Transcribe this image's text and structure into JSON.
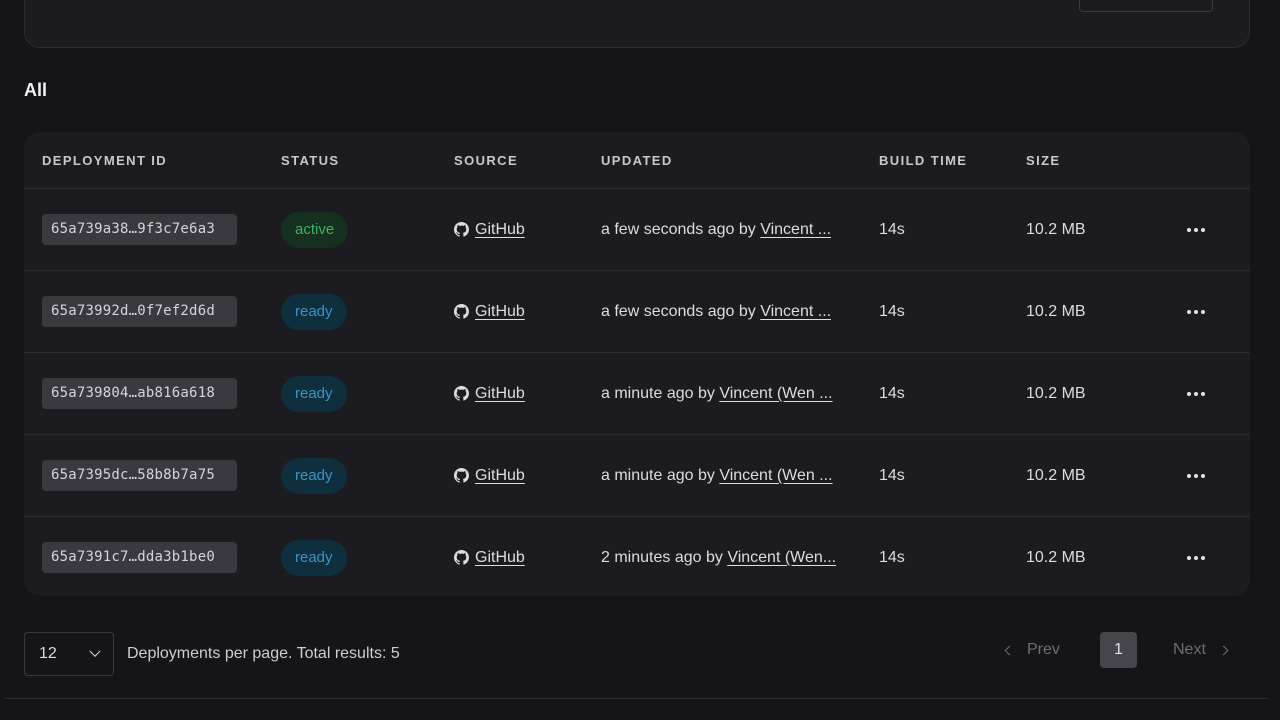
{
  "section_title": "All",
  "columns": {
    "deployment_id": "DEPLOYMENT ID",
    "status": "STATUS",
    "source": "SOURCE",
    "updated": "UPDATED",
    "build_time": "BUILD TIME",
    "size": "SIZE"
  },
  "rows": [
    {
      "id": "65a739a38…9f3c7e6a3",
      "status": "active",
      "source": "GitHub",
      "updated_prefix": "a few seconds ago by",
      "updated_by": "Vincent ...",
      "build_time": "14s",
      "size": "10.2 MB"
    },
    {
      "id": "65a73992d…0f7ef2d6d",
      "status": "ready",
      "source": "GitHub",
      "updated_prefix": "a few seconds ago by",
      "updated_by": "Vincent ...",
      "build_time": "14s",
      "size": "10.2 MB"
    },
    {
      "id": "65a739804…ab816a618",
      "status": "ready",
      "source": "GitHub",
      "updated_prefix": "a minute ago by",
      "updated_by": "Vincent (Wen ...",
      "build_time": "14s",
      "size": "10.2 MB"
    },
    {
      "id": "65a7395dc…58b8b7a75",
      "status": "ready",
      "source": "GitHub",
      "updated_prefix": "a minute ago by",
      "updated_by": "Vincent (Wen ...",
      "build_time": "14s",
      "size": "10.2 MB"
    },
    {
      "id": "65a7391c7…dda3b1be0",
      "status": "ready",
      "source": "GitHub",
      "updated_prefix": "2 minutes ago by",
      "updated_by": "Vincent (Wen...",
      "build_time": "14s",
      "size": "10.2 MB"
    }
  ],
  "pagination": {
    "per_page": "12",
    "label": "Deployments per page. Total results: 5",
    "prev": "Prev",
    "current_page": "1",
    "next": "Next"
  },
  "colors": {
    "background": "#151418",
    "card": "#1c1b20",
    "active_badge_text": "#3fb267",
    "ready_badge_text": "#3a94c6"
  },
  "icons": {
    "source": "github-icon",
    "row_menu": "more-horizontal-icon",
    "select": "chevron-down-icon",
    "prev": "chevron-left-icon",
    "next": "chevron-right-icon"
  }
}
